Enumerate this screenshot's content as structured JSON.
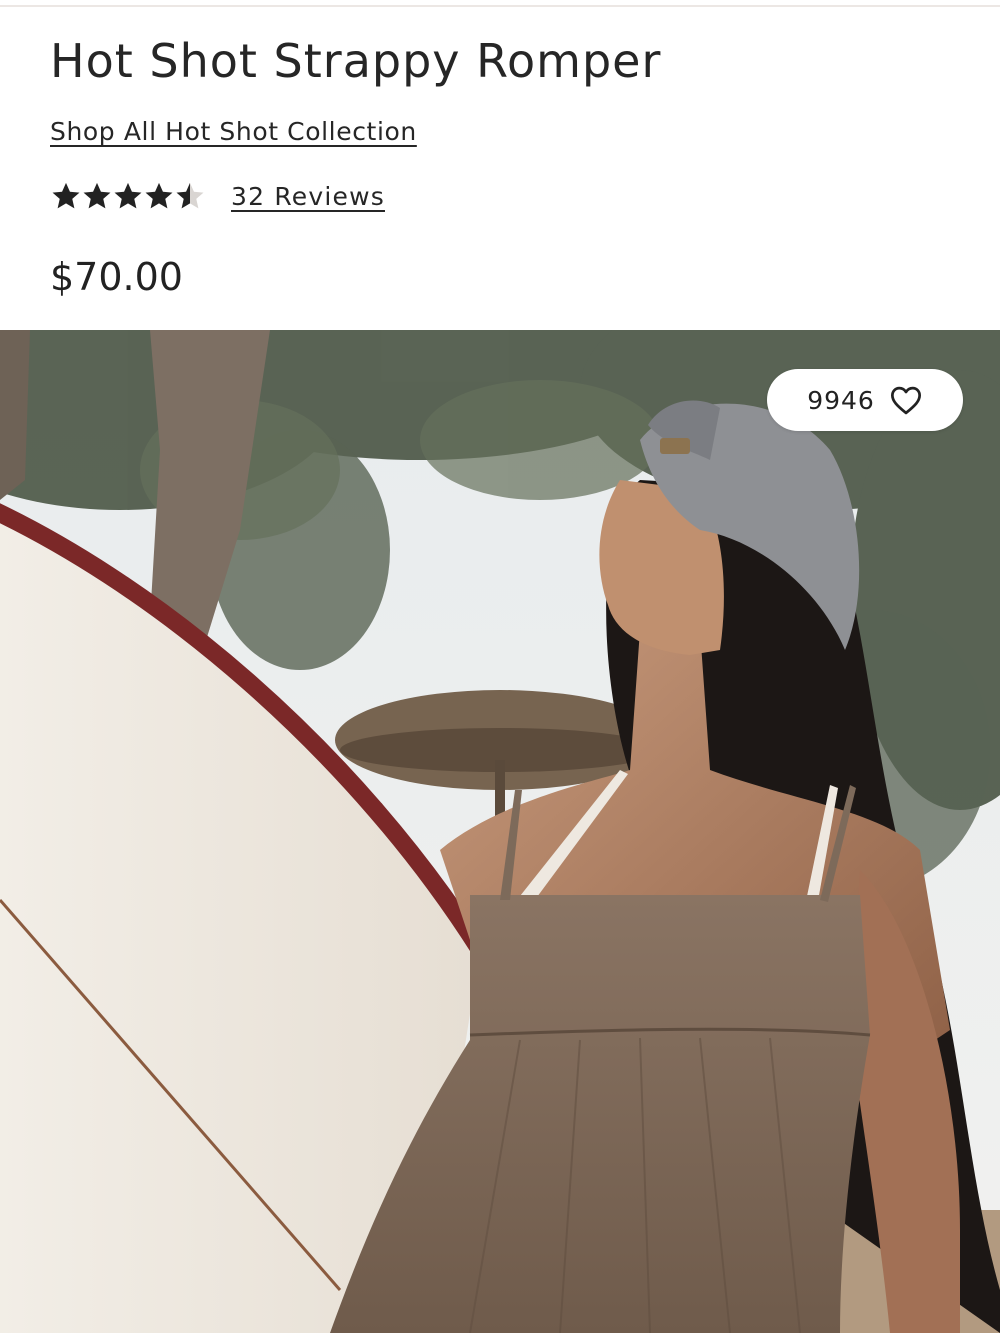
{
  "product": {
    "title": "Hot Shot Strappy Romper",
    "collection_link": "Shop All Hot Shot Collection",
    "rating": 4.5,
    "rating_max": 5,
    "reviews_label": "32 Reviews",
    "price": "$70.00"
  },
  "gallery": {
    "like_count": "9946",
    "like_icon": "heart-outline-icon"
  },
  "colors": {
    "star": "#222222",
    "star_empty": "#d9d5d2",
    "text": "#262626"
  }
}
